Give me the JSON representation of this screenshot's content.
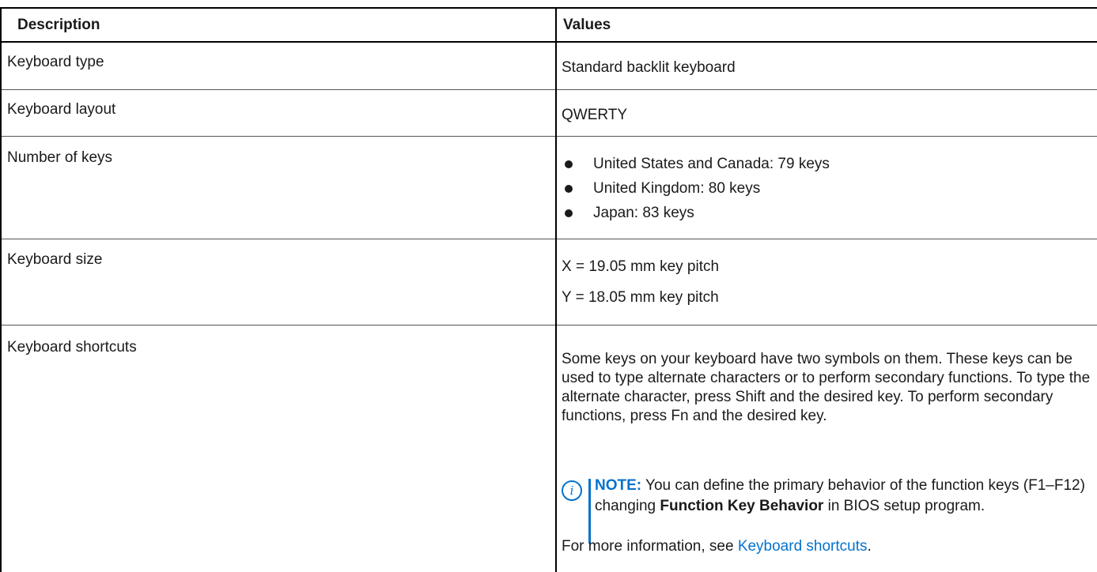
{
  "table": {
    "headers": {
      "description": "Description",
      "values": "Values"
    },
    "rows": [
      {
        "description": "Keyboard type",
        "value": "Standard backlit keyboard"
      },
      {
        "description": "Keyboard layout",
        "value": "QWERTY"
      },
      {
        "description": "Number of keys",
        "bullets": [
          "United States and Canada: 79 keys",
          "United Kingdom: 80 keys",
          "Japan: 83 keys"
        ]
      },
      {
        "description": "Keyboard size",
        "lines": [
          "X = 19.05 mm key pitch",
          "Y = 18.05 mm key pitch"
        ]
      },
      {
        "description": "Keyboard shortcuts",
        "paragraph": "Some keys on your keyboard have two symbols on them. These keys can be used to type alternate characters or to perform secondary functions. To type the alternate character, press Shift and the desired key. To perform secondary functions, press Fn and the desired key.",
        "note": {
          "icon": "info-icon",
          "label": "NOTE:",
          "text_before": " You can define the primary behavior of the function keys (F1–F12) changing ",
          "bold": "Function Key Behavior",
          "text_after": " in BIOS setup program."
        },
        "more_info_prefix": "For more information, see ",
        "more_info_link": "Keyboard shortcuts",
        "more_info_suffix": "."
      }
    ]
  },
  "colors": {
    "link": "#0672cb",
    "text": "#1a1a1a",
    "border": "#000000"
  }
}
